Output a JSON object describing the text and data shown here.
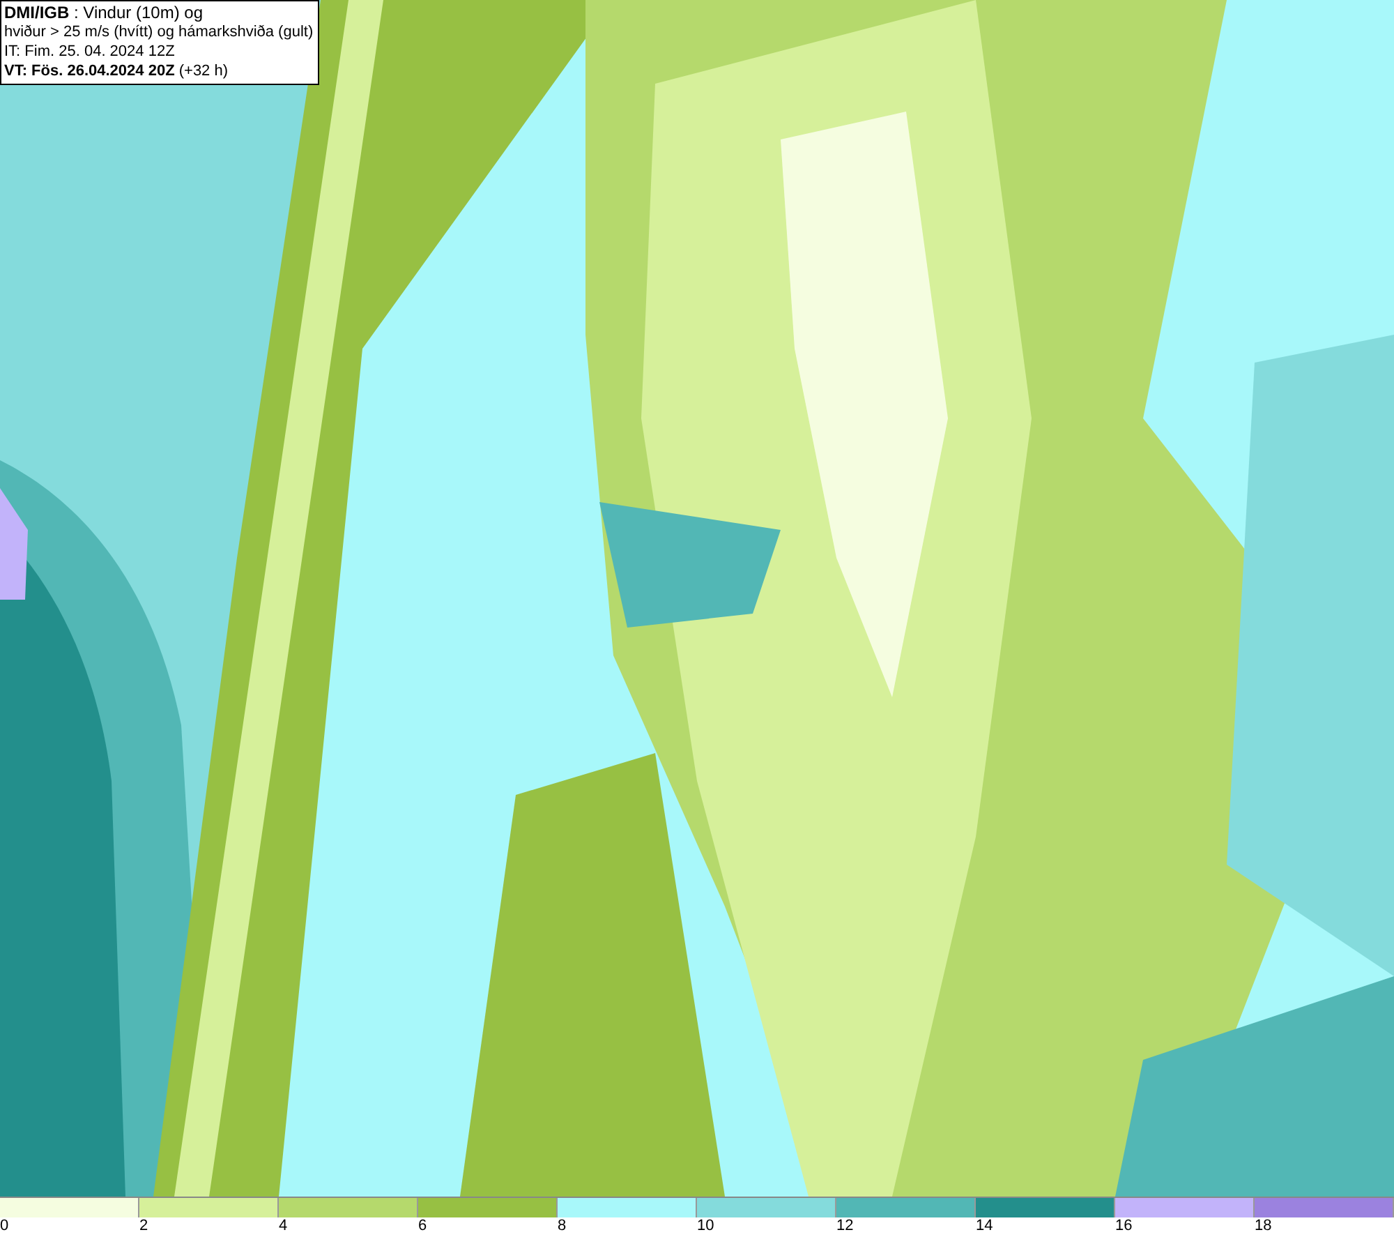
{
  "title_box": {
    "lines": [
      "**DMI/IGB** : Vindur (10m) og",
      "hviður > 25 m/s (hvítt) og hámarkshviða (gult)",
      "IT: Fim. 25. 04. 2024 12Z",
      "**VT: Fös. 26.04.2024 20Z** (+32 h)"
    ]
  },
  "legend": [
    {
      "label": "0",
      "color": "#f5fde0"
    },
    {
      "label": "2",
      "color": "#d6f09a"
    },
    {
      "label": "4",
      "color": "#b5d96c"
    },
    {
      "label": "6",
      "color": "#97c043"
    },
    {
      "label": "8",
      "color": "#a8f8fa"
    },
    {
      "label": "10",
      "color": "#84dbdc"
    },
    {
      "label": "12",
      "color": "#52b7b5"
    },
    {
      "label": "14",
      "color": "#238f8c"
    },
    {
      "label": "16",
      "color": "#c2b3fa"
    },
    {
      "label": "18",
      "color": "#9b82df"
    }
  ]
}
